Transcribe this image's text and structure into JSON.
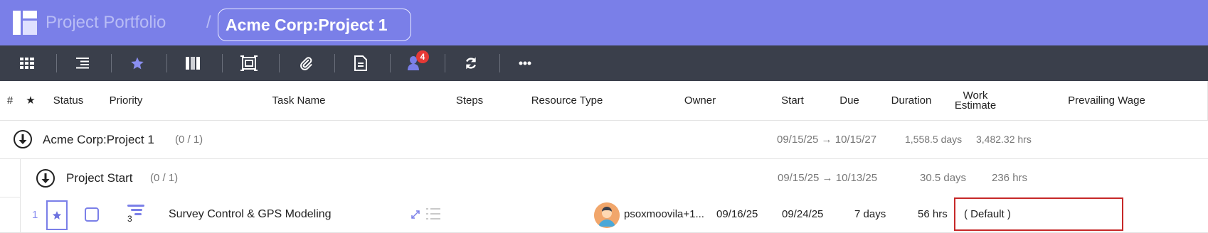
{
  "header": {
    "app_title": "Project Portfolio",
    "separator": "/",
    "breadcrumb": "Acme Corp:Project 1"
  },
  "toolbar": {
    "buttons": [
      {
        "icon": "grid-view-icon"
      },
      {
        "icon": "indent-list-icon"
      },
      {
        "icon": "star-icon"
      },
      {
        "icon": "columns-icon"
      },
      {
        "icon": "fit-screen-icon"
      },
      {
        "icon": "paperclip-icon"
      },
      {
        "icon": "document-icon"
      },
      {
        "icon": "people-icon",
        "badge": "4"
      },
      {
        "icon": "refresh-icon"
      },
      {
        "icon": "more-icon"
      }
    ]
  },
  "columns": {
    "num": "#",
    "star": "★",
    "status": "Status",
    "priority": "Priority",
    "task_name": "Task Name",
    "steps": "Steps",
    "resource_type": "Resource Type",
    "owner": "Owner",
    "start": "Start",
    "due": "Due",
    "duration": "Duration",
    "work_estimate_line1": "Work",
    "work_estimate_line2": "Estimate",
    "prevailing_wage": "Prevailing Wage"
  },
  "project_row": {
    "name": "Acme Corp:Project 1",
    "count": "(0 / 1)",
    "dates": "09/15/25 → 10/15/27",
    "duration": "1,558.5 days",
    "work": "3,482.32 hrs"
  },
  "group_row": {
    "name": "Project Start",
    "count": "(0 / 1)",
    "dates": "09/15/25 → 10/13/25",
    "duration": "30.5 days",
    "work": "236 hrs"
  },
  "task_row": {
    "num": "1",
    "priority_level": "3",
    "name": "Survey Control & GPS Modeling",
    "owner": "psoxmoovila+1...",
    "start": "09/16/25",
    "due": "09/24/25",
    "duration": "7 days",
    "work": "56 hrs",
    "prevailing_wage": "( Default )"
  },
  "colors": {
    "header_bg": "#7a7fe8",
    "toolbar_bg": "#3a3f4b",
    "accent": "#7a7fe8",
    "badge": "#e53935",
    "highlight_border": "#c62828"
  }
}
